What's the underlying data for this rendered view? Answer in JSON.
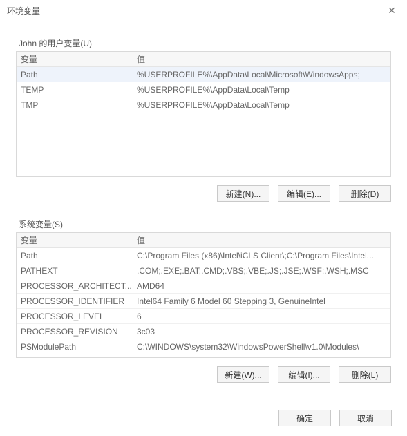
{
  "window": {
    "title": "环境变量",
    "close_glyph": "✕"
  },
  "user_group": {
    "caption": "John 的用户变量(U)",
    "header_var": "变量",
    "header_val": "值",
    "rows": [
      {
        "name": "Path",
        "value": "%USERPROFILE%\\AppData\\Local\\Microsoft\\WindowsApps;"
      },
      {
        "name": "TEMP",
        "value": "%USERPROFILE%\\AppData\\Local\\Temp"
      },
      {
        "name": "TMP",
        "value": "%USERPROFILE%\\AppData\\Local\\Temp"
      }
    ],
    "selected_index": 0,
    "buttons": {
      "new": "新建(N)...",
      "edit": "编辑(E)...",
      "delete": "删除(D)"
    }
  },
  "sys_group": {
    "caption": "系统变量(S)",
    "header_var": "变量",
    "header_val": "值",
    "rows": [
      {
        "name": "Path",
        "value": "C:\\Program Files (x86)\\Intel\\iCLS Client\\;C:\\Program Files\\Intel..."
      },
      {
        "name": "PATHEXT",
        "value": ".COM;.EXE;.BAT;.CMD;.VBS;.VBE;.JS;.JSE;.WSF;.WSH;.MSC"
      },
      {
        "name": "PROCESSOR_ARCHITECT...",
        "value": "AMD64"
      },
      {
        "name": "PROCESSOR_IDENTIFIER",
        "value": "Intel64 Family 6 Model 60 Stepping 3, GenuineIntel"
      },
      {
        "name": "PROCESSOR_LEVEL",
        "value": "6"
      },
      {
        "name": "PROCESSOR_REVISION",
        "value": "3c03"
      },
      {
        "name": "PSModulePath",
        "value": "C:\\WINDOWS\\system32\\WindowsPowerShell\\v1.0\\Modules\\"
      }
    ],
    "selected_index": -1,
    "buttons": {
      "new": "新建(W)...",
      "edit": "编辑(I)...",
      "delete": "删除(L)"
    }
  },
  "dialog_buttons": {
    "ok": "确定",
    "cancel": "取消"
  }
}
